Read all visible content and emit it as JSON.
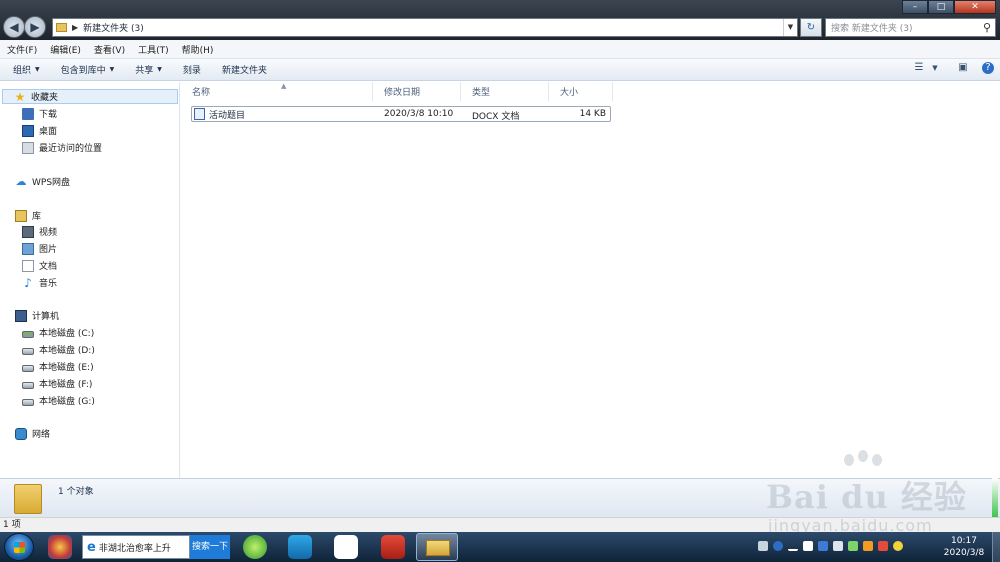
{
  "window": {
    "address_path": "新建文件夹 (3)",
    "search_placeholder": "搜索 新建文件夹 (3)",
    "controls": {
      "minimize": "–",
      "maximize": "□",
      "close": "✕"
    }
  },
  "menu": [
    "文件(F)",
    "编辑(E)",
    "查看(V)",
    "工具(T)",
    "帮助(H)"
  ],
  "toolbar": {
    "organize": "组织",
    "include_library": "包含到库中",
    "share": "共享",
    "burn": "刻录",
    "new_folder": "新建文件夹"
  },
  "nav": {
    "favorites": "收藏夹",
    "downloads": "下载",
    "desktop": "桌面",
    "recent": "最近访问的位置",
    "wps": "WPS网盘",
    "library": "库",
    "videos": "视频",
    "pictures": "图片",
    "documents": "文档",
    "music": "音乐",
    "computer": "计算机",
    "drives": [
      "本地磁盘 (C:)",
      "本地磁盘 (D:)",
      "本地磁盘 (E:)",
      "本地磁盘 (F:)",
      "本地磁盘 (G:)"
    ],
    "network": "网络"
  },
  "columns": {
    "name": "名称",
    "modified": "修改日期",
    "type": "类型",
    "size": "大小"
  },
  "files": [
    {
      "name": "活动题目",
      "modified": "2020/3/8 10:10",
      "type": "DOCX 文档",
      "size": "14 KB"
    }
  ],
  "details": {
    "object_count": "1 个对象"
  },
  "status": {
    "items": "1 项"
  },
  "watermark": {
    "brand": "Bai du 经验",
    "url": "jingyan.baidu.com"
  },
  "taskbar": {
    "ie_tab": "非湖北治愈率上升",
    "search_button": "搜索一下",
    "clock_time": "10:17",
    "clock_date": "2020/3/8"
  },
  "colors": {
    "selection": "#e5f0fb",
    "taskbar": "#1a3350",
    "accent": "#1f7bd8"
  }
}
